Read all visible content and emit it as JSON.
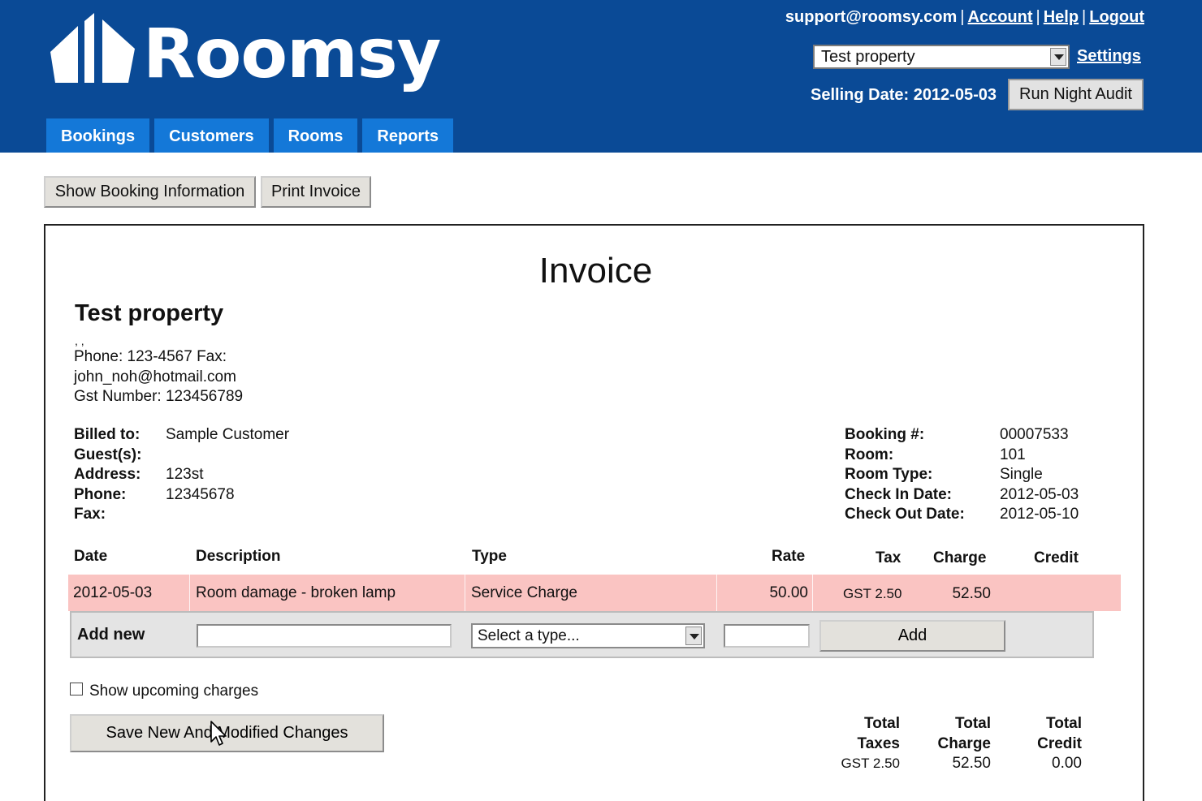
{
  "brand": {
    "name": "Roomsy"
  },
  "top_links": {
    "email": "support@roomsy.com",
    "account": "Account",
    "help": "Help",
    "logout": "Logout",
    "separator": "|"
  },
  "property_select": {
    "value": "Test property"
  },
  "settings_label": "Settings",
  "selling_date": "Selling Date: 2012-05-03",
  "night_audit_label": "Run Night Audit",
  "nav": {
    "bookings": "Bookings",
    "customers": "Customers",
    "rooms": "Rooms",
    "reports": "Reports"
  },
  "actions": {
    "show_booking": "Show Booking Information",
    "print_invoice": "Print Invoice"
  },
  "invoice": {
    "title": "Invoice",
    "property_name": "Test property",
    "address_commas": ",  ,",
    "property_lines": [
      "Phone: 123-4567  Fax:",
      "john_noh@hotmail.com",
      "Gst Number: 123456789"
    ]
  },
  "billed": {
    "billed_to_label": "Billed to:",
    "billed_to": "Sample Customer",
    "guests_label": "Guest(s):",
    "guests": "",
    "address_label": "Address:",
    "address": "123st",
    "phone_label": "Phone:",
    "phone": "12345678",
    "fax_label": "Fax:",
    "fax": ""
  },
  "booking": {
    "number_label": "Booking #:",
    "number": "00007533",
    "room_label": "Room:",
    "room": "101",
    "room_type_label": "Room Type:",
    "room_type": "Single",
    "check_in_label": "Check In Date:",
    "check_in": "2012-05-03",
    "check_out_label": "Check Out Date:",
    "check_out": "2012-05-10"
  },
  "table": {
    "headers": {
      "date": "Date",
      "description": "Description",
      "type": "Type",
      "rate": "Rate",
      "tax": "Tax",
      "charge": "Charge",
      "credit": "Credit"
    },
    "rows": [
      {
        "date": "2012-05-03",
        "description": "Room damage - broken lamp",
        "type": "Service Charge",
        "rate": "50.00",
        "tax": "GST 2.50",
        "charge": "52.50",
        "credit": ""
      }
    ]
  },
  "add_new": {
    "label": "Add new",
    "description_value": "",
    "type_placeholder": "Select a type...",
    "rate_value": "",
    "add_label": "Add"
  },
  "upcoming_label": "Show upcoming charges",
  "save_label": "Save New And Modified Changes",
  "totals": {
    "taxes_l1": "Total",
    "taxes_l2": "Taxes",
    "taxes_value": "GST 2.50",
    "charge_l1": "Total",
    "charge_l2": "Charge",
    "charge_value": "52.50",
    "credit_l1": "Total",
    "credit_l2": "Credit",
    "credit_value": "0.00"
  },
  "colors": {
    "header_bg": "#0a4a96",
    "tab_bg": "#1478d8",
    "row_highlight": "#fac4c2"
  }
}
